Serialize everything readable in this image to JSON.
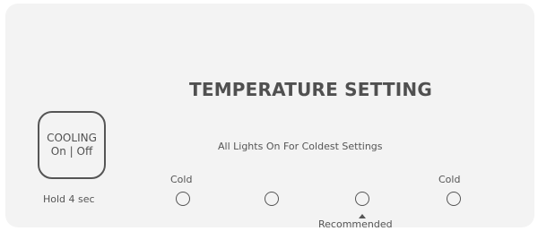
{
  "panel": {
    "title": "TEMPERATURE SETTING",
    "subtitle": "All Lights On For Coldest Settings",
    "cooling_button": {
      "line1": "COOLING",
      "line2": "On | Off",
      "hint": "Hold 4 sec"
    },
    "cold_left_label": "Cold",
    "cold_right_label": "Cold",
    "recommended_label": "Recommended",
    "indicator_count": 4,
    "recommended_indicator_index": 3
  },
  "colors": {
    "panel_background": "#f3f3f3",
    "ink": "#555555"
  }
}
